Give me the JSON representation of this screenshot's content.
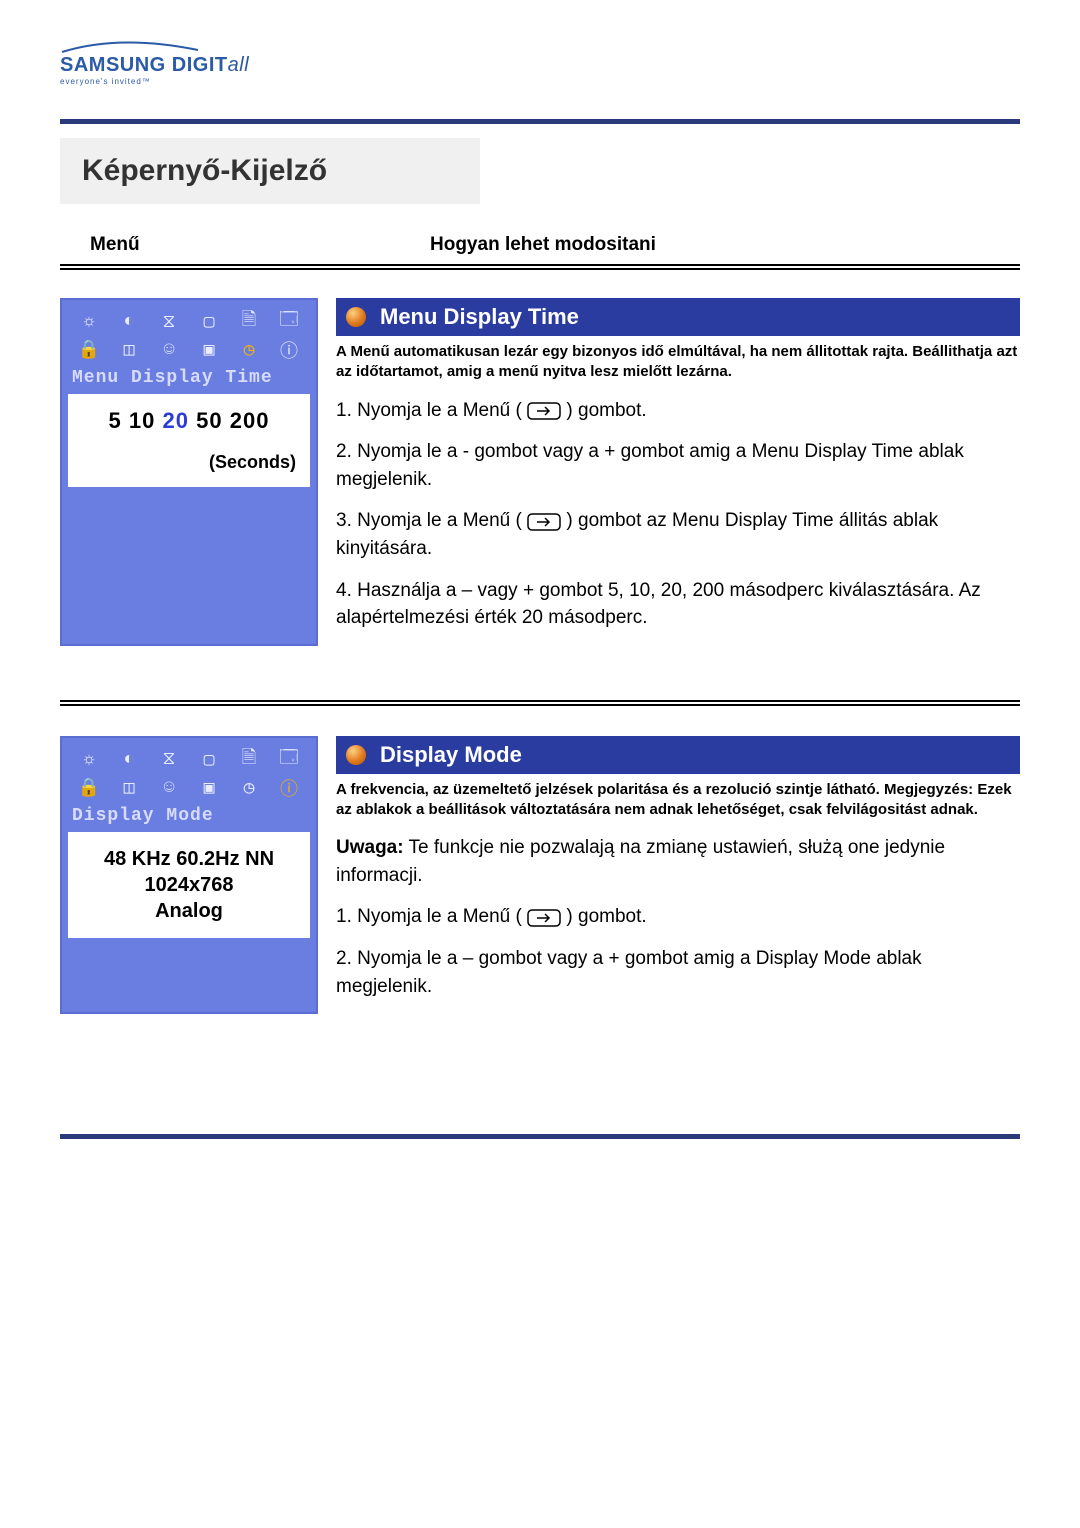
{
  "logo": {
    "brand_main": "SAMSUNG DIGIT",
    "brand_tail": "all",
    "tagline": "everyone's invited™"
  },
  "page_title": "Képernyő-Kijelző",
  "columns": {
    "left": "Menű",
    "right": "Hogyan lehet modositani"
  },
  "section1": {
    "osd_label": "Menu Display Time",
    "osd_values": [
      "5",
      "10",
      "20",
      "50",
      "200"
    ],
    "osd_selected_index": 2,
    "osd_unit": "(Seconds)",
    "title": "Menu Display Time",
    "desc": "A Menű automatikusan lezár egy bizonyos idő elmúltával, ha nem állitottak rajta. Beállithatja azt az időtartamot, amig a menű nyitva lesz mielőtt lezárna.",
    "steps": {
      "s1a": "1. Nyomja le a Menű  ( ",
      "s1b": " ) gombot.",
      "s2": "2. Nyomja le a - gombot vagy a + gombot amig a Menu Display Time ablak megjelenik.",
      "s3a": "3. Nyomja le a Menű ( ",
      "s3b": " ) gombot az Menu Display Time állitás ablak kinyitására.",
      "s4": "4. Használja a – vagy + gombot 5, 10, 20, 200 másodperc kiválasztására. Az alapértelmezési érték 20 másodperc."
    }
  },
  "section2": {
    "osd_label": "Display Mode",
    "dm_line1": "48 KHz 60.2Hz NN",
    "dm_line2": "1024x768",
    "dm_line3": "Analog",
    "title": "Display Mode",
    "desc": "A frekvencia, az üzemeltető jelzések polaritása és a rezolució szintje látható. Megjegyzés: Ezek az ablakok a beállitások változtatására nem adnak lehetőséget, csak felvilágositást adnak.",
    "note_label": "Uwaga:",
    "note_text": " Te funkcje nie pozwalają na zmianę ustawień, służą one jedynie informacji.",
    "steps": {
      "s1a": "1. Nyomja le a Menű  ( ",
      "s1b": " ) gombot.",
      "s2": "2. Nyomja le a – gombot vagy a + gombot amig a Display Mode ablak megjelenik."
    }
  },
  "icons": {
    "row1": [
      "brightness-icon",
      "contrast-icon",
      "hourglass-icon",
      "position-icon",
      "lock-icon",
      "camera-icon"
    ],
    "row2": [
      "person-lock-icon",
      "color-icon",
      "smiley-icon",
      "window-icon",
      "clock-icon",
      "info-icon"
    ]
  }
}
